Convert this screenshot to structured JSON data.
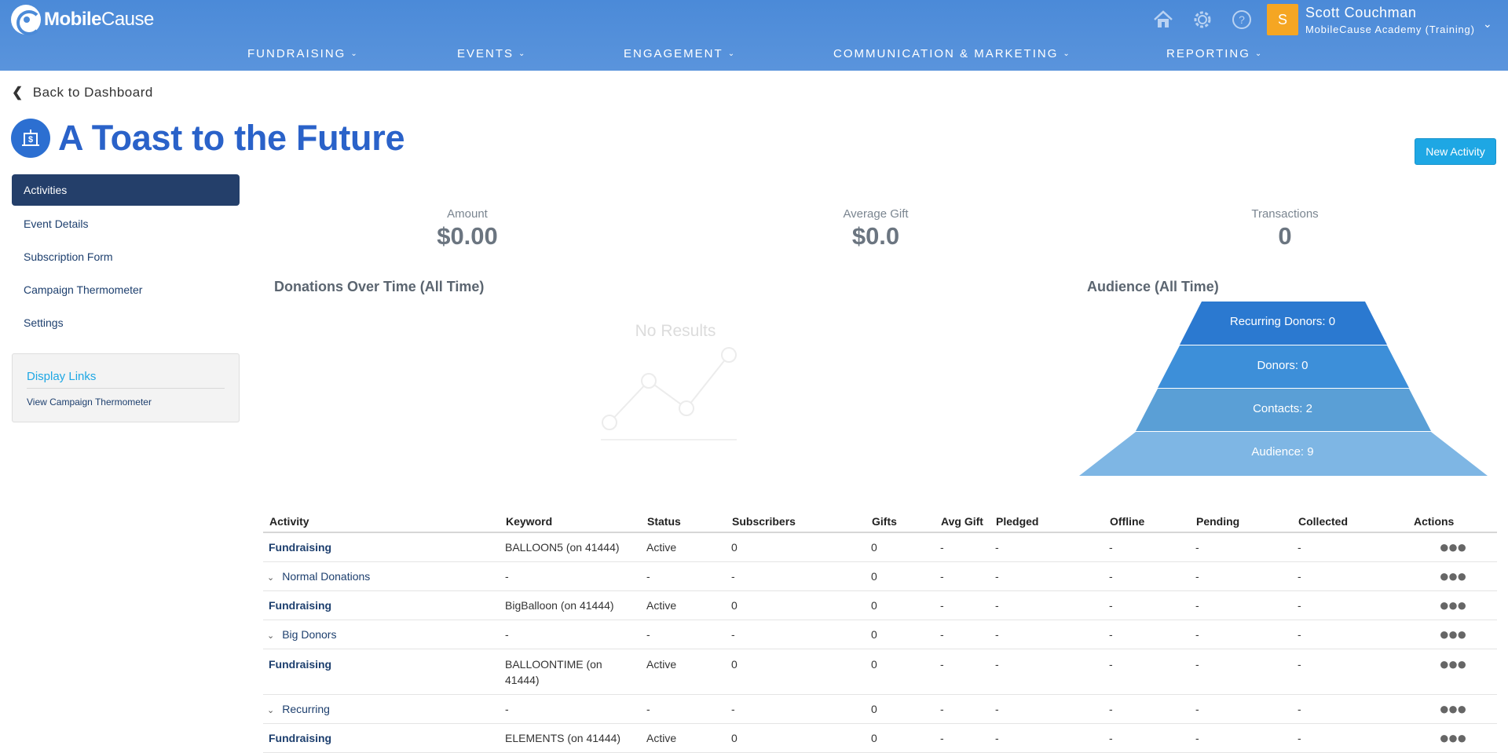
{
  "app": {
    "logo_bold": "Mobile",
    "logo_light": "Cause"
  },
  "header": {
    "icons": [
      "home-icon",
      "gear-icon",
      "help-icon"
    ],
    "avatar_initial": "S",
    "user_name": "Scott Couchman",
    "user_org": "MobileCause Academy (Training)",
    "brand_color": "#4b8ad8"
  },
  "nav": {
    "items": [
      {
        "label": "FUNDRAISING"
      },
      {
        "label": "EVENTS"
      },
      {
        "label": "ENGAGEMENT"
      },
      {
        "label": "COMMUNICATION & MARKETING"
      },
      {
        "label": "REPORTING"
      }
    ]
  },
  "back_link": "Back to Dashboard",
  "page_title": "A Toast to the Future",
  "new_activity_button": "New Activity",
  "sidebar": {
    "items": [
      {
        "label": "Activities",
        "active": true
      },
      {
        "label": "Event Details"
      },
      {
        "label": "Subscription Form"
      },
      {
        "label": "Campaign Thermometer"
      },
      {
        "label": "Settings"
      }
    ],
    "links_title": "Display Links",
    "links": [
      "View Campaign Thermometer"
    ]
  },
  "stats": {
    "amount_label": "Amount",
    "amount_value": "$0.00",
    "avg_label": "Average Gift",
    "avg_value": "$0.0",
    "transactions_label": "Transactions",
    "transactions_value": "0"
  },
  "donations_chart": {
    "title": "Donations Over Time (All Time)",
    "empty_text": "No Results"
  },
  "audience": {
    "title": "Audience (All Time)",
    "levels": [
      {
        "label": "Recurring Donors: 0",
        "color": "#2b79d0"
      },
      {
        "label": "Donors: 0",
        "color": "#3d8fd9"
      },
      {
        "label": "Contacts: 2",
        "color": "#5a9fd6"
      },
      {
        "label": "Audience: 9",
        "color": "#7eb6e4"
      }
    ]
  },
  "table": {
    "headers": [
      "Activity",
      "Keyword",
      "Status",
      "Subscribers",
      "Gifts",
      "Avg Gift",
      "Pledged",
      "Offline",
      "Pending",
      "Collected",
      "Actions"
    ],
    "rows": [
      {
        "type": "main",
        "activity": "Fundraising",
        "keyword": "BALLOON5 (on 41444)",
        "status": "Active",
        "subscribers": "0",
        "gifts": "0",
        "avg": "-",
        "pledged": "-",
        "offline": "-",
        "pending": "-",
        "collected": "-"
      },
      {
        "type": "sub",
        "activity": "Normal Donations",
        "keyword": "-",
        "status": "-",
        "subscribers": "-",
        "gifts": "0",
        "avg": "-",
        "pledged": "-",
        "offline": "-",
        "pending": "-",
        "collected": "-"
      },
      {
        "type": "main",
        "activity": "Fundraising",
        "keyword": "BigBalloon (on 41444)",
        "status": "Active",
        "subscribers": "0",
        "gifts": "0",
        "avg": "-",
        "pledged": "-",
        "offline": "-",
        "pending": "-",
        "collected": "-"
      },
      {
        "type": "sub",
        "activity": "Big Donors",
        "keyword": "-",
        "status": "-",
        "subscribers": "-",
        "gifts": "0",
        "avg": "-",
        "pledged": "-",
        "offline": "-",
        "pending": "-",
        "collected": "-"
      },
      {
        "type": "main-wrap",
        "activity": "Fundraising",
        "keyword": "BALLOONTIME (on 41444)",
        "status": "Active",
        "subscribers": "0",
        "gifts": "0",
        "avg": "-",
        "pledged": "-",
        "offline": "-",
        "pending": "-",
        "collected": "-"
      },
      {
        "type": "sub",
        "activity": "Recurring",
        "keyword": "-",
        "status": "-",
        "subscribers": "-",
        "gifts": "0",
        "avg": "-",
        "pledged": "-",
        "offline": "-",
        "pending": "-",
        "collected": "-"
      },
      {
        "type": "main",
        "activity": "Fundraising",
        "keyword": "ELEMENTS (on 41444)",
        "status": "Active",
        "subscribers": "0",
        "gifts": "0",
        "avg": "-",
        "pledged": "-",
        "offline": "-",
        "pending": "-",
        "collected": "-"
      }
    ]
  }
}
